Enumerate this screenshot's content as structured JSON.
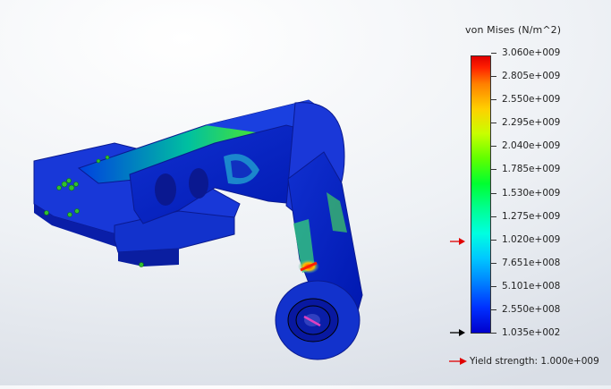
{
  "legend": {
    "title": "von Mises (N/m^2)",
    "ticks": [
      "3.060e+009",
      "2.805e+009",
      "2.550e+009",
      "2.295e+009",
      "2.040e+009",
      "1.785e+009",
      "1.530e+009",
      "1.275e+009",
      "1.020e+009",
      "7.651e+008",
      "5.101e+008",
      "2.550e+008",
      "1.035e+002"
    ],
    "yield_label": "Yield strength: 1.000e+009",
    "yield_marker_value": 1000000000,
    "min_marker_value": 103.5,
    "yield_marker_color": "#e00000",
    "min_marker_color": "#000000"
  },
  "colors": {
    "low": "#0000cc",
    "mid": "#00ff90",
    "high": "#e00000"
  }
}
